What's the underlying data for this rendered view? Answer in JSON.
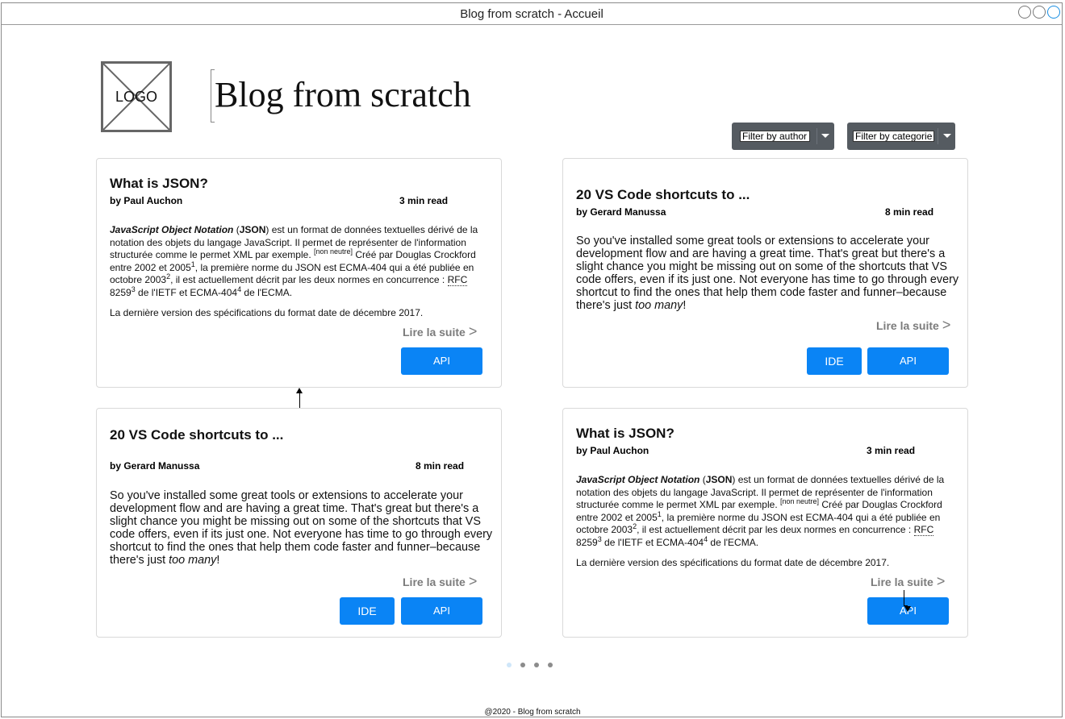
{
  "window": {
    "title": "Blog from scratch - Accueil"
  },
  "header": {
    "logo_text": "LOGO",
    "site_title": "Blog from scratch"
  },
  "filters": {
    "author": "Filter by author",
    "category": "Filter by categorie"
  },
  "posts": [
    {
      "title": "What is JSON?",
      "author": "by Paul Auchon",
      "read_time": "3 min read",
      "read_more": "Lire la suite",
      "tags": [
        "API"
      ]
    },
    {
      "title": "20 VS Code shortcuts to ...",
      "author": "by Gerard Manussa",
      "read_time": "8 min read",
      "excerpt_main": "So you've installed some great tools or extensions to accelerate your development flow and are having a great time. That's great but there's a slight chance you might be missing out on some of the shortcuts that VS code offers, even if its just one. Not everyone has time to go through every shortcut to find the ones that help them code faster and funner–because there's just ",
      "excerpt_em": "too many",
      "excerpt_end": "!",
      "read_more": "Lire la suite",
      "tags": [
        "IDE",
        "API"
      ]
    },
    {
      "title": "20 VS Code shortcuts to ...",
      "author": "by Gerard Manussa",
      "read_time": "8 min read",
      "excerpt_main": "So you've installed some great tools or extensions to accelerate your development flow and are having a great time. That's great but there's a slight chance you might be missing out on some of the shortcuts that VS code offers, even if its just one. Not everyone has time to go through every shortcut to find the ones that help them code faster and funner–because there's just ",
      "excerpt_em": "too many",
      "excerpt_end": "!",
      "read_more": "Lire la suite",
      "tags": [
        "IDE",
        "API"
      ]
    },
    {
      "title": "What is JSON?",
      "author": "by Paul Auchon",
      "read_time": "3 min read",
      "read_more": "Lire la suite",
      "tags": [
        "API"
      ]
    }
  ],
  "json_excerpt": {
    "term": "JavaScript Object Notation",
    "acronym": "JSON",
    "t1": " est un format de données textuelles dérivé de la notation des objets du langage JavaScript. Il permet de représenter de l'information structurée comme le permet XML par exemple. ",
    "note": "[non neutre]",
    "t2": " Créé par Douglas Crockford entre 2002 et 2005",
    "s1": "1",
    "t3": ", la première norme du JSON est ECMA-404 qui a été publiée en octobre 2003",
    "s2": "2",
    "t4": ", il est actuellement décrit par les deux normes en concurrence : ",
    "rfc": "RFC",
    "t5": " 8259",
    "s3": "3",
    "t6": " de l'IETF et ECMA-404",
    "s4": "4",
    "t7": " de l'ECMA.",
    "p2": "La dernière version des spécifications du format date de décembre 2017."
  },
  "common": {
    "read_more_arrow": ">"
  },
  "pagination": {
    "pages": 4,
    "current": 1
  },
  "footer": {
    "text": "@2020 - Blog from scratch"
  }
}
